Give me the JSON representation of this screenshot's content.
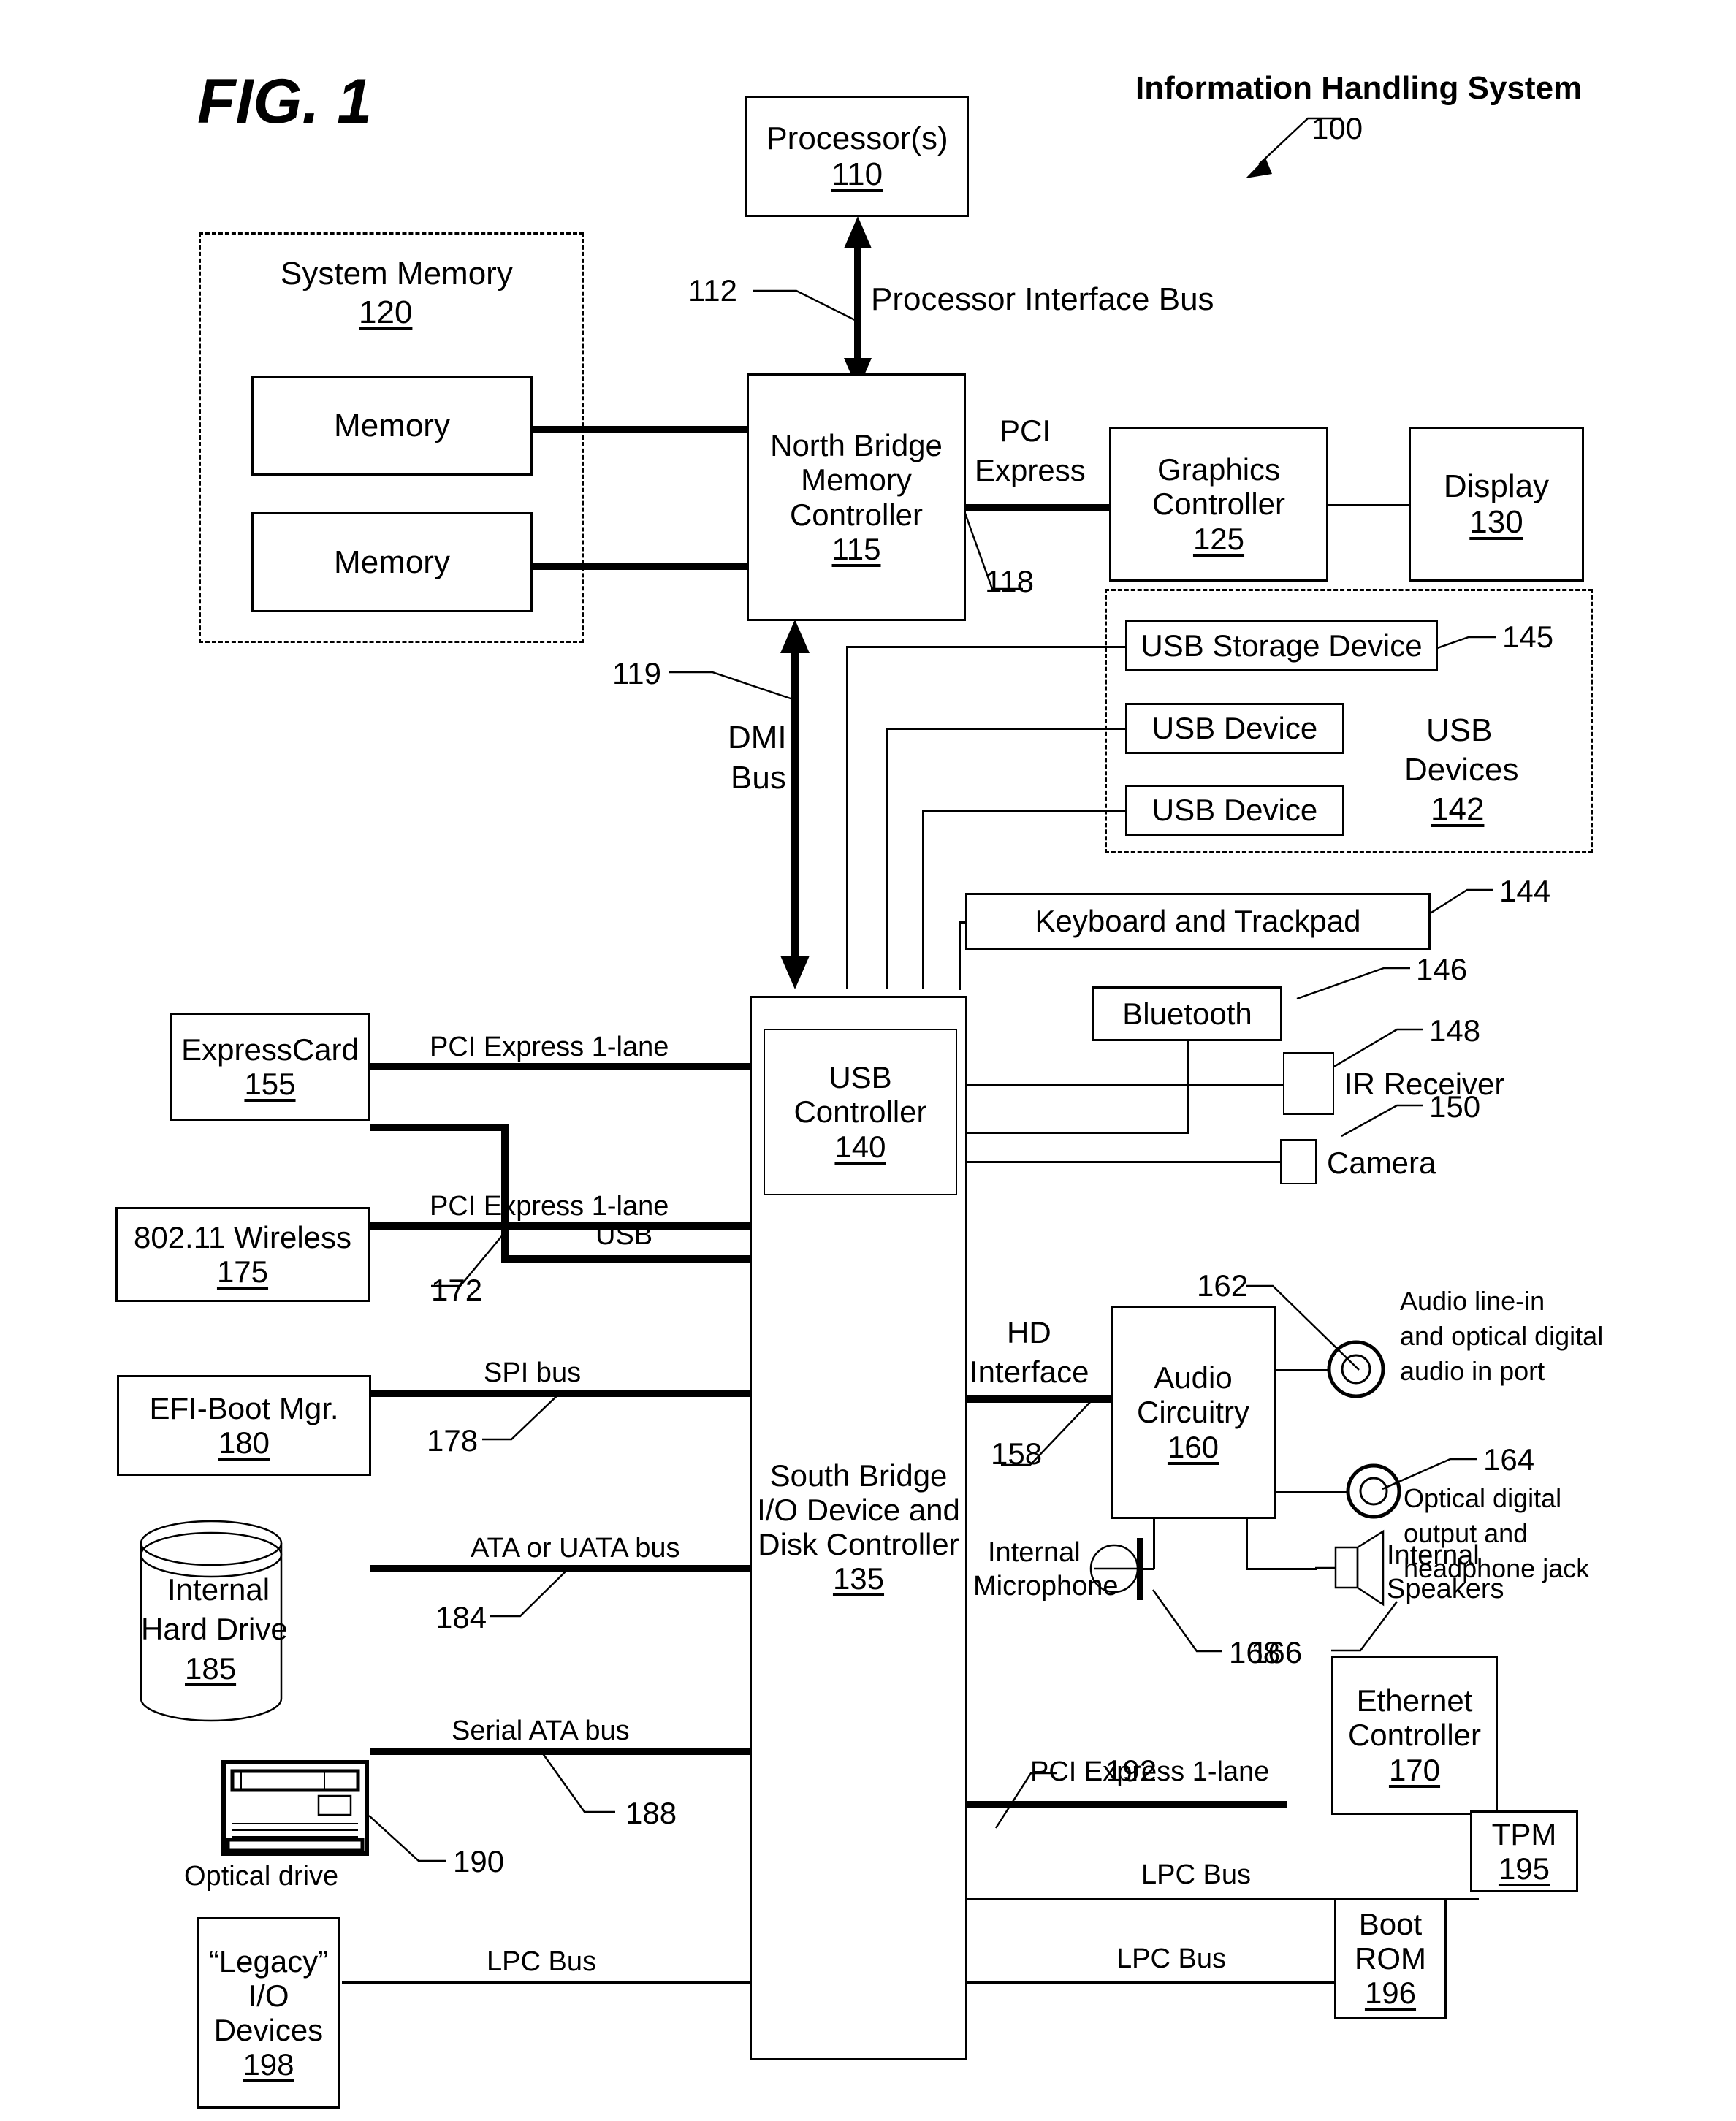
{
  "figure": {
    "label": "FIG. 1",
    "system_title": "Information Handling System",
    "system_ref": "100"
  },
  "blocks": {
    "processor": {
      "label": "Processor(s)",
      "ref": "110"
    },
    "system_memory": {
      "label": "System Memory",
      "ref": "120"
    },
    "memory_1": {
      "label": "Memory"
    },
    "memory_2": {
      "label": "Memory"
    },
    "north_bridge": {
      "line1": "North Bridge",
      "line2": "Memory",
      "line3": "Controller",
      "ref": "115"
    },
    "graphics": {
      "line1": "Graphics",
      "line2": "Controller",
      "ref": "125"
    },
    "display": {
      "label": "Display",
      "ref": "130"
    },
    "usb_storage": {
      "label": "USB Storage Device",
      "ref": "145"
    },
    "usb_device_1": {
      "label": "USB Device"
    },
    "usb_device_2": {
      "label": "USB Device"
    },
    "usb_devices_group": {
      "line1": "USB",
      "line2": "Devices",
      "ref": "142"
    },
    "keyboard": {
      "label": "Keyboard and Trackpad",
      "ref": "144"
    },
    "bluetooth": {
      "label": "Bluetooth",
      "ref": "146"
    },
    "ir_receiver": {
      "label": "IR Receiver",
      "ref": "148"
    },
    "camera": {
      "label": "Camera",
      "ref": "150"
    },
    "usb_controller": {
      "line1": "USB",
      "line2": "Controller",
      "ref": "140"
    },
    "expresscard": {
      "label": "ExpressCard",
      "ref": "155"
    },
    "wireless": {
      "label": "802.11 Wireless",
      "ref": "175"
    },
    "efi_boot_mgr": {
      "label": "EFI-Boot Mgr.",
      "ref": "180"
    },
    "hard_drive": {
      "line1": "Internal",
      "line2": "Hard Drive",
      "ref": "185"
    },
    "optical_drive": {
      "label": "Optical drive",
      "ref": "190"
    },
    "legacy_io": {
      "line1": "“Legacy”",
      "line2": "I/O",
      "line3": "Devices",
      "ref": "198"
    },
    "south_bridge": {
      "line1": "South Bridge",
      "line2": "I/O Device and",
      "line3": "Disk Controller",
      "ref": "135"
    },
    "audio": {
      "line1": "Audio",
      "line2": "Circuitry",
      "ref": "160"
    },
    "audio_in_port": {
      "line1": "Audio line-in",
      "line2": "and optical digital",
      "line3": "audio in port",
      "ref": "162"
    },
    "audio_out_port": {
      "line1": "Optical digital",
      "line2": "output and",
      "line3": "headphone jack",
      "ref": "164"
    },
    "internal_mic": {
      "line1": "Internal",
      "line2": "Microphone",
      "ref": "168"
    },
    "internal_speakers": {
      "line1": "Internal",
      "line2": "Speakers",
      "ref": "166"
    },
    "ethernet": {
      "line1": "Ethernet",
      "line2": "Controller",
      "ref": "170"
    },
    "tpm": {
      "label": "TPM",
      "ref": "195"
    },
    "boot_rom": {
      "line1": "Boot",
      "line2": "ROM",
      "ref": "196"
    }
  },
  "buses": {
    "processor_interface": {
      "label": "Processor Interface Bus",
      "ref": "112"
    },
    "pci_express_gfx": {
      "line1": "PCI",
      "line2": "Express",
      "ref": "118"
    },
    "dmi": {
      "line1": "DMI",
      "line2": "Bus",
      "ref": "119"
    },
    "pcie_expresscard": {
      "label": "PCI Express 1-lane"
    },
    "usb_expresscard": {
      "label": "USB"
    },
    "pcie_wireless": {
      "label": "PCI Express 1-lane",
      "ref": "172"
    },
    "spi": {
      "label": "SPI bus",
      "ref": "178"
    },
    "ata": {
      "label": "ATA or UATA bus",
      "ref": "184"
    },
    "serial_ata": {
      "label": "Serial ATA bus",
      "ref": "188"
    },
    "pcie_ethernet": {
      "label": "PCI Express 1-lane"
    },
    "lpc_tpm": {
      "label": "LPC Bus",
      "ref": "192"
    },
    "lpc_bootrom": {
      "label": "LPC Bus"
    },
    "lpc_legacy": {
      "label": "LPC Bus"
    },
    "hd_interface": {
      "line1": "HD",
      "line2": "Interface",
      "ref": "158"
    }
  }
}
